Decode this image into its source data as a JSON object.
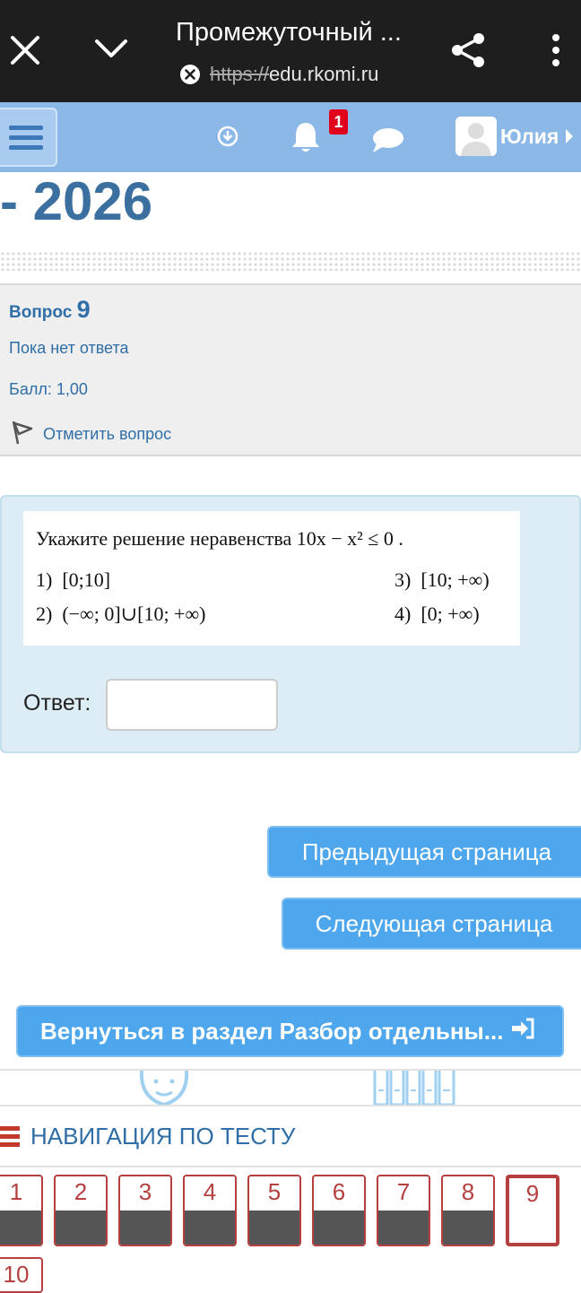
{
  "browser": {
    "title": "Промежуточный ...",
    "url_scheme": "https://",
    "url_host": "edu.rkomi.ru"
  },
  "navbar": {
    "notification_count": "1",
    "user_name": "Юлия"
  },
  "page": {
    "heading": "- 2026"
  },
  "question_info": {
    "label": "Вопрос",
    "number": "9",
    "state": "Пока нет ответа",
    "grade": "Балл: 1,00",
    "flag_label": "Отметить вопрос"
  },
  "question": {
    "prompt": "Укажите решение неравенства  10x − x² ≤ 0 .",
    "options": [
      {
        "num": "1)",
        "text": "[0;10]"
      },
      {
        "num": "2)",
        "text": "(−∞; 0]∪[10; +∞)"
      },
      {
        "num": "3)",
        "text": "[10; +∞)"
      },
      {
        "num": "4)",
        "text": "[0; +∞)"
      }
    ],
    "answer_label": "Ответ:",
    "answer_value": ""
  },
  "buttons": {
    "prev": "Предыдущая страница",
    "next": "Следующая страница",
    "back": "Вернуться в раздел Разбор отдельны..."
  },
  "quiz_nav": {
    "title": "НАВИГАЦИЯ ПО ТЕСТУ",
    "items": [
      "1",
      "2",
      "3",
      "4",
      "5",
      "6",
      "7",
      "8",
      "9",
      "10"
    ],
    "current": "9"
  },
  "colors": {
    "navbar": "#8cb8e8",
    "link": "#2f6ea6",
    "button": "#4ea6ec",
    "nav_accent": "#b54040"
  }
}
